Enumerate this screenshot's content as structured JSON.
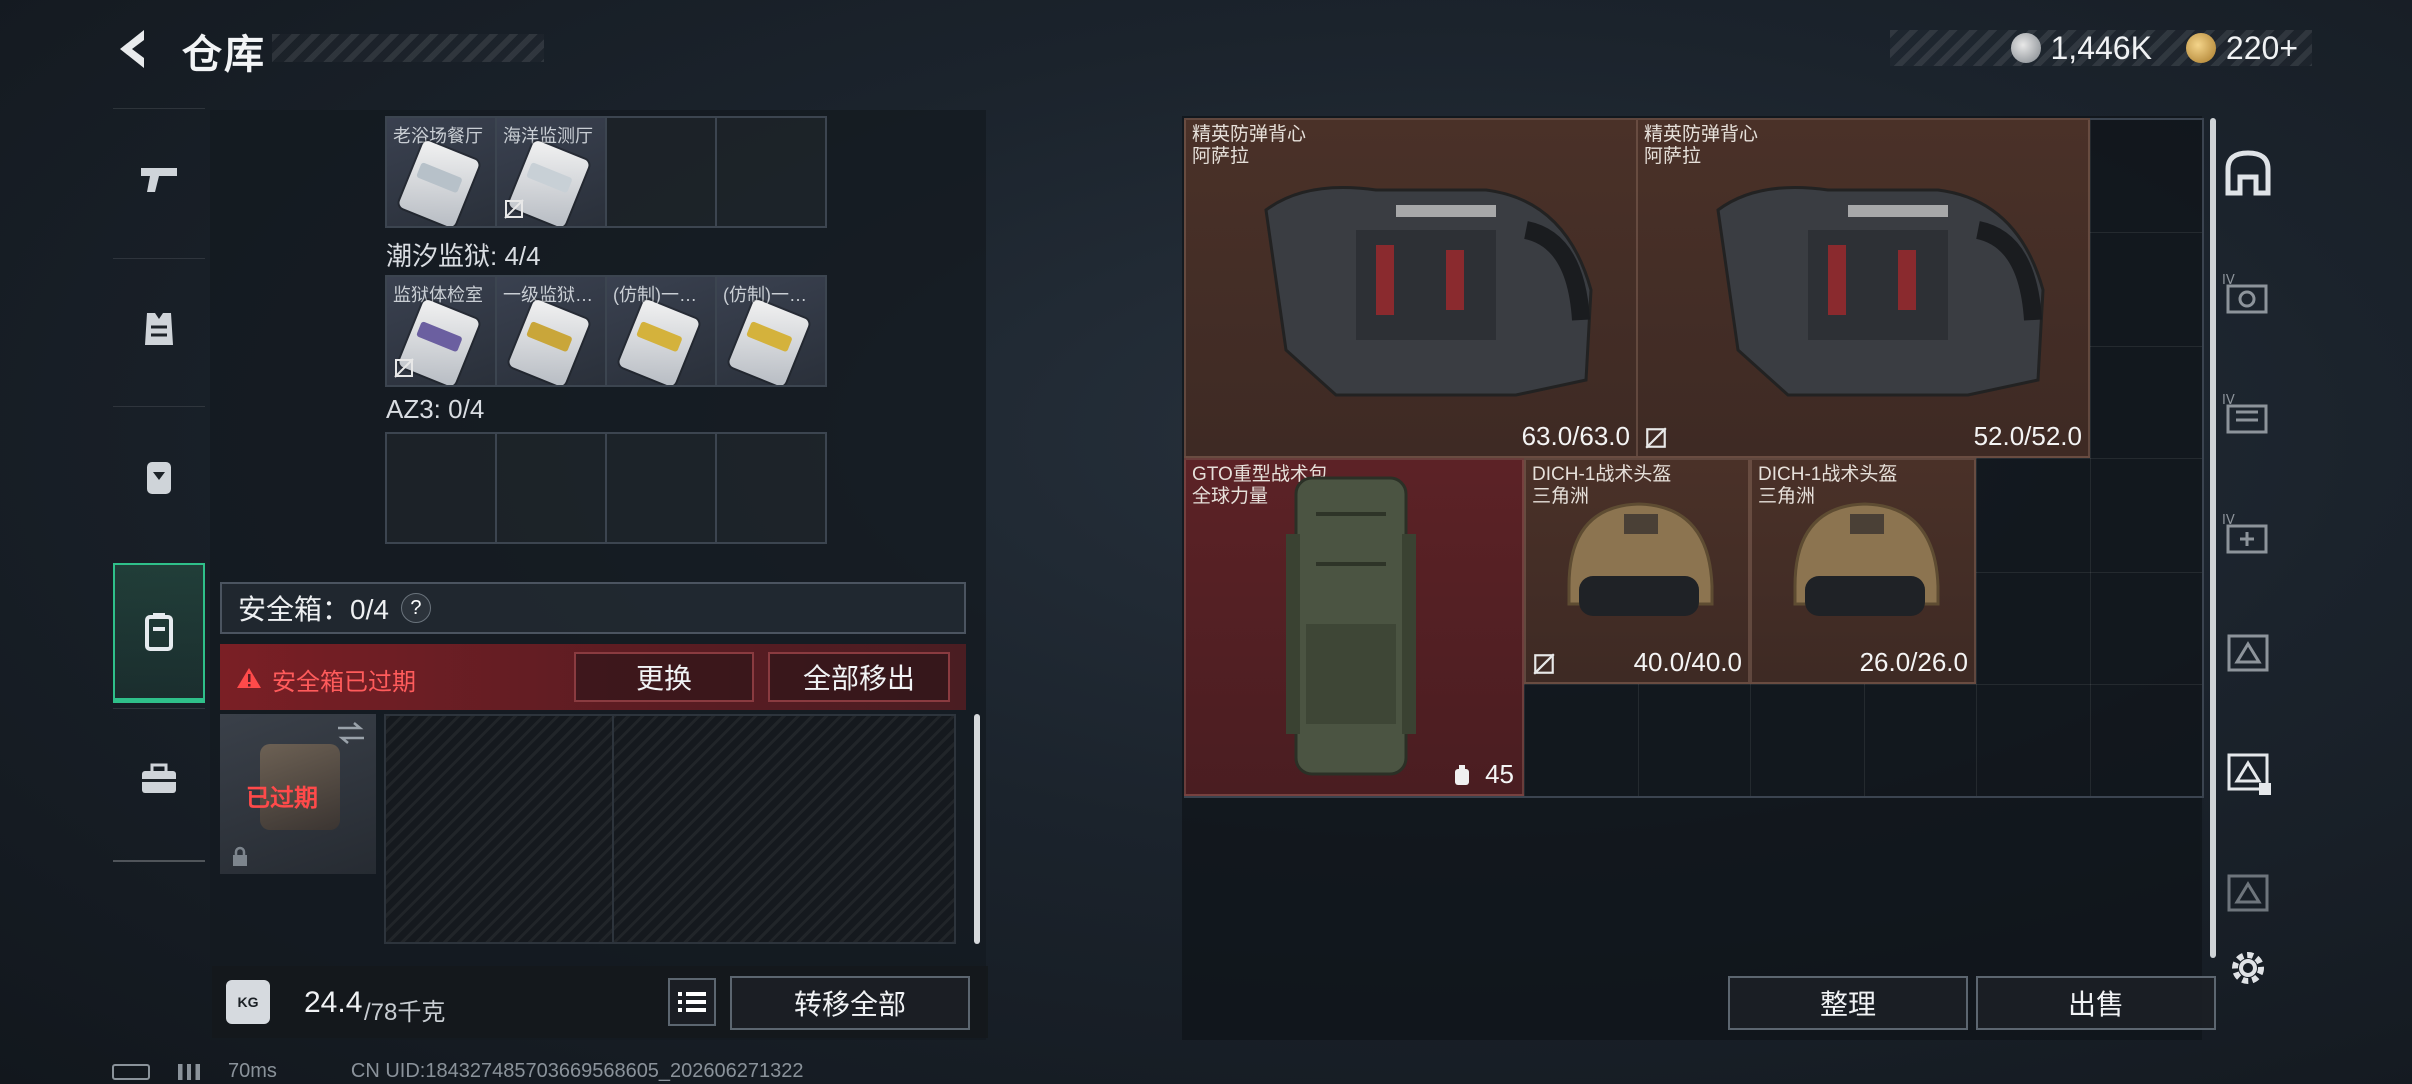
{
  "header": {
    "title": "仓库",
    "currency_silver": "1,446K",
    "currency_gold": "220+"
  },
  "left_tabs": [
    {
      "icon": "pistol-icon"
    },
    {
      "icon": "armor-vest-icon"
    },
    {
      "icon": "backpack-icon"
    },
    {
      "icon": "safebox-icon",
      "active": true
    },
    {
      "icon": "toolbox-icon"
    }
  ],
  "left_panel": {
    "row1_cells": [
      "老浴场餐厅",
      "海洋监测厅",
      "",
      ""
    ],
    "section_prison": "潮汐监狱: 4/4",
    "row2_cells": [
      "监狱体检室",
      "一级监狱…",
      "(仿制)一…",
      "(仿制)一…"
    ],
    "section_az3": "AZ3: 0/4",
    "safebox_label": "安全箱：0/4",
    "safebox_help": "?",
    "safebox_expired": "安全箱已过期",
    "btn_replace": "更换",
    "btn_move_all_out": "全部移出",
    "safebox_slot_expired": "已过期",
    "weight_value": "24.4",
    "weight_max": "/78千克",
    "btn_transfer_all": "转移全部"
  },
  "stash_items": [
    {
      "name": "精英防弹背心",
      "sub": "阿萨拉",
      "durability": "63.0/63.0"
    },
    {
      "name": "精英防弹背心",
      "sub": "阿萨拉",
      "durability": "52.0/52.0"
    },
    {
      "name": "GTO重型战术包",
      "sub": "全球力量",
      "slots": "45"
    },
    {
      "name": "DICH-1战术头盔",
      "sub": "三角洲",
      "durability": "40.0/40.0"
    },
    {
      "name": "DICH-1战术头盔",
      "sub": "三角洲",
      "durability": "26.0/26.0"
    }
  ],
  "right_buttons": {
    "sort": "整理",
    "sell": "出售"
  },
  "right_tabs": [
    "home-stash-icon",
    "stash-iv-camera-icon",
    "stash-iv-box-icon",
    "stash-iv-plus-icon",
    "stash-triangle-icon",
    "stash-triangle-locked-icon",
    "stash-triangle-dim-icon",
    "settings-gear-icon"
  ],
  "status_bar": {
    "ping": "70ms",
    "uid": "CN UID:184327485703669568605_202606271322"
  }
}
